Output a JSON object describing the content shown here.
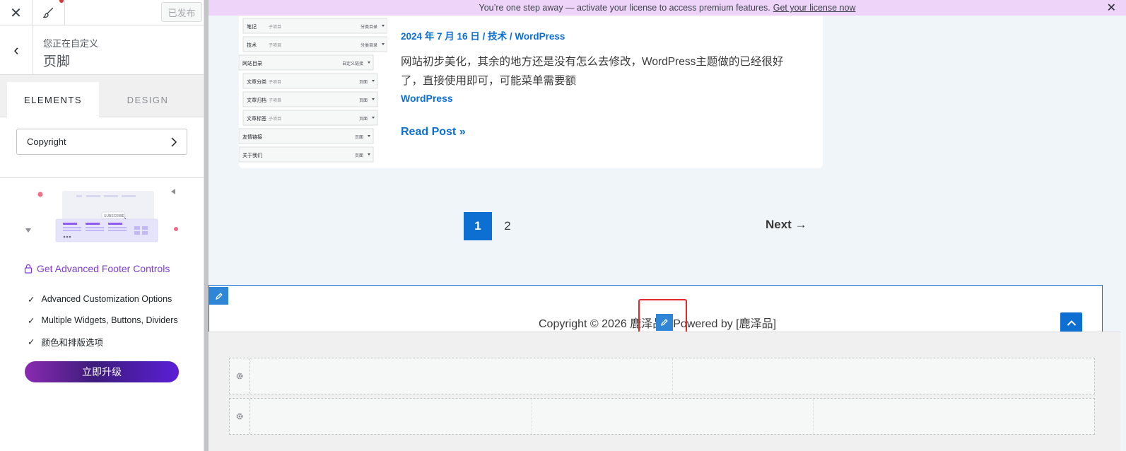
{
  "topbar": {
    "publish_label": "已发布"
  },
  "breadcrumb": {
    "context": "您正在自定义",
    "title": "页脚"
  },
  "tabs": [
    {
      "label": "ELEMENTS"
    },
    {
      "label": "DESIGN"
    }
  ],
  "element_item": {
    "label": "Copyright"
  },
  "upsell": {
    "illustration_badge": "SUBSCRIBE",
    "title": "Get Advanced Footer Controls",
    "features": [
      "Advanced Customization Options",
      "Multiple Widgets, Buttons, Dividers",
      "颜色和排版选项"
    ],
    "button_label": "立即升级"
  },
  "notice": {
    "text": "You’re one step away — activate your license to access premium features.",
    "link": "Get your license now"
  },
  "post": {
    "date": "2024 年 7 月 16 日",
    "sep": " / ",
    "category": "技术",
    "category2": "WordPress",
    "excerpt": "网站初步美化，其余的地方还是没有怎么去修改，WordPress主题做的已经很好了，直接使用即可，可能菜单需要额",
    "tag": "WordPress",
    "read_more": "Read Post »"
  },
  "thumbnail_rows": [
    {
      "left": "笔记",
      "sub": "子项目",
      "right": "分类目录"
    },
    {
      "left": "技术",
      "sub": "子项目",
      "right": "分类目录"
    },
    {
      "left": "网站目录",
      "sub": "",
      "right": "自定义链接"
    },
    {
      "left": "文章分类",
      "sub": "子项目",
      "right": "页面"
    },
    {
      "left": "文章归档",
      "sub": "子项目",
      "right": "页面"
    },
    {
      "left": "文章标签",
      "sub": "子项目",
      "right": "页面"
    },
    {
      "left": "友情链接",
      "sub": "",
      "right": "页面"
    },
    {
      "left": "关于我们",
      "sub": "",
      "right": "页面"
    }
  ],
  "pagination": {
    "current": "1",
    "page2": "2",
    "next": "Next →"
  },
  "footer": {
    "copyright": "Copyright © 2026 鹿泽品 | Powered by [鹿泽品]"
  },
  "colors": {
    "accent": "#0e6fd3",
    "notice_bg": "#efd4fa",
    "upsell": "#7f3bdb",
    "highlight": "#e32a2a"
  }
}
